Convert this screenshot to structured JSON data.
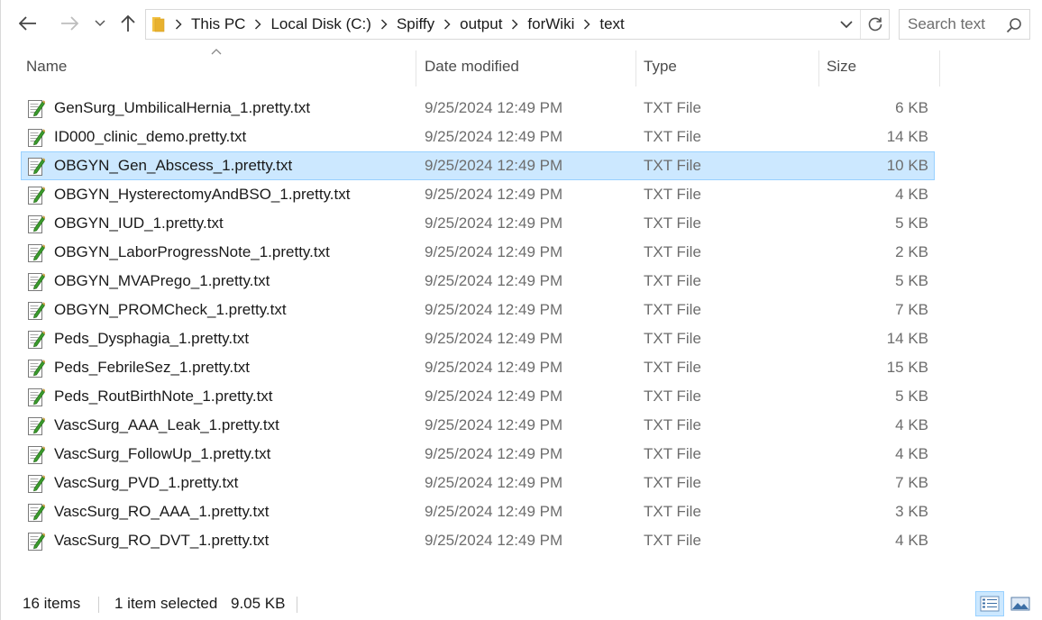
{
  "nav": {
    "back_icon": "arrow-left-icon",
    "forward_icon": "arrow-right-icon",
    "recent_icon": "chevron-down-icon",
    "up_icon": "arrow-up-icon"
  },
  "address": {
    "crumbs": [
      "This PC",
      "Local Disk (C:)",
      "Spiffy",
      "output",
      "forWiki",
      "text"
    ]
  },
  "search": {
    "placeholder": "Search text"
  },
  "columns": {
    "name": "Name",
    "date": "Date modified",
    "type": "Type",
    "size": "Size"
  },
  "files": [
    {
      "name": "GenSurg_UmbilicalHernia_1.pretty.txt",
      "date": "9/25/2024 12:49 PM",
      "type": "TXT File",
      "size": "6 KB",
      "selected": false
    },
    {
      "name": "ID000_clinic_demo.pretty.txt",
      "date": "9/25/2024 12:49 PM",
      "type": "TXT File",
      "size": "14 KB",
      "selected": false
    },
    {
      "name": "OBGYN_Gen_Abscess_1.pretty.txt",
      "date": "9/25/2024 12:49 PM",
      "type": "TXT File",
      "size": "10 KB",
      "selected": true
    },
    {
      "name": "OBGYN_HysterectomyAndBSO_1.pretty.txt",
      "date": "9/25/2024 12:49 PM",
      "type": "TXT File",
      "size": "4 KB",
      "selected": false
    },
    {
      "name": "OBGYN_IUD_1.pretty.txt",
      "date": "9/25/2024 12:49 PM",
      "type": "TXT File",
      "size": "5 KB",
      "selected": false
    },
    {
      "name": "OBGYN_LaborProgressNote_1.pretty.txt",
      "date": "9/25/2024 12:49 PM",
      "type": "TXT File",
      "size": "2 KB",
      "selected": false
    },
    {
      "name": "OBGYN_MVAPrego_1.pretty.txt",
      "date": "9/25/2024 12:49 PM",
      "type": "TXT File",
      "size": "5 KB",
      "selected": false
    },
    {
      "name": "OBGYN_PROMCheck_1.pretty.txt",
      "date": "9/25/2024 12:49 PM",
      "type": "TXT File",
      "size": "7 KB",
      "selected": false
    },
    {
      "name": "Peds_Dysphagia_1.pretty.txt",
      "date": "9/25/2024 12:49 PM",
      "type": "TXT File",
      "size": "14 KB",
      "selected": false
    },
    {
      "name": "Peds_FebrileSez_1.pretty.txt",
      "date": "9/25/2024 12:49 PM",
      "type": "TXT File",
      "size": "15 KB",
      "selected": false
    },
    {
      "name": "Peds_RoutBirthNote_1.pretty.txt",
      "date": "9/25/2024 12:49 PM",
      "type": "TXT File",
      "size": "5 KB",
      "selected": false
    },
    {
      "name": "VascSurg_AAA_Leak_1.pretty.txt",
      "date": "9/25/2024 12:49 PM",
      "type": "TXT File",
      "size": "4 KB",
      "selected": false
    },
    {
      "name": "VascSurg_FollowUp_1.pretty.txt",
      "date": "9/25/2024 12:49 PM",
      "type": "TXT File",
      "size": "4 KB",
      "selected": false
    },
    {
      "name": "VascSurg_PVD_1.pretty.txt",
      "date": "9/25/2024 12:49 PM",
      "type": "TXT File",
      "size": "7 KB",
      "selected": false
    },
    {
      "name": "VascSurg_RO_AAA_1.pretty.txt",
      "date": "9/25/2024 12:49 PM",
      "type": "TXT File",
      "size": "3 KB",
      "selected": false
    },
    {
      "name": "VascSurg_RO_DVT_1.pretty.txt",
      "date": "9/25/2024 12:49 PM",
      "type": "TXT File",
      "size": "4 KB",
      "selected": false
    }
  ],
  "status": {
    "item_count": "16 items",
    "selected": "1 item selected",
    "selected_size": "9.05 KB"
  },
  "colors": {
    "selection_bg": "#cce8ff",
    "selection_border": "#99d1ff",
    "folder": "#f3c243",
    "text_icon_pencil": "#3a9b2c"
  }
}
